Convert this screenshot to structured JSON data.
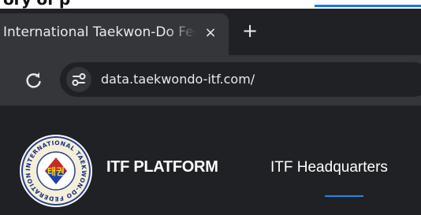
{
  "top_banner": {
    "text": "ory of p",
    "link_color": "#1a73e8"
  },
  "browser": {
    "tab": {
      "title": "International Taekwon-Do Federation",
      "close_glyph": "×"
    },
    "new_tab_glyph": "+",
    "toolbar": {
      "reload_icon": "reload-icon",
      "site_info_icon": "tune-icon",
      "url": "data.taekwondo-itf.com/"
    }
  },
  "site": {
    "logo": {
      "ring_text": "INTERNATIONAL TAEKWON-DO FEDERATION",
      "center_text": "태권"
    },
    "brand": "ITF PLATFORM",
    "nav": [
      {
        "label": "ITF Headquarters",
        "active": true
      }
    ],
    "accent_color": "#1e88e5"
  }
}
